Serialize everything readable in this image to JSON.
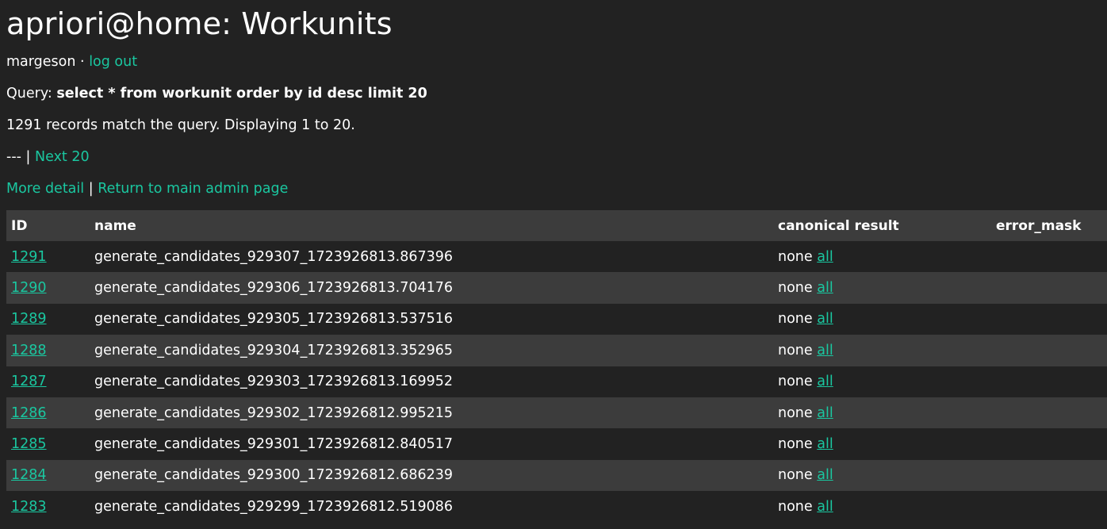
{
  "header": {
    "title": "apriori@home: Workunits"
  },
  "user": {
    "name": "margeson",
    "separator": "·",
    "logout_label": "log out"
  },
  "query": {
    "label": "Query:",
    "text": "select * from workunit order by id desc limit 20"
  },
  "records_info": "1291 records match the query. Displaying 1 to 20.",
  "pagination": {
    "prev": "---",
    "sep": "|",
    "next_label": "Next 20"
  },
  "links": {
    "more_detail": "More detail",
    "sep": "|",
    "return_admin": "Return to main admin page"
  },
  "table": {
    "headers": [
      "ID",
      "name",
      "canonical result",
      "error_mask"
    ],
    "rows": [
      {
        "id": "1291",
        "name": "generate_candidates_929307_1723926813.867396",
        "canonical": "none",
        "all": "all"
      },
      {
        "id": "1290",
        "name": "generate_candidates_929306_1723926813.704176",
        "canonical": "none",
        "all": "all"
      },
      {
        "id": "1289",
        "name": "generate_candidates_929305_1723926813.537516",
        "canonical": "none",
        "all": "all"
      },
      {
        "id": "1288",
        "name": "generate_candidates_929304_1723926813.352965",
        "canonical": "none",
        "all": "all"
      },
      {
        "id": "1287",
        "name": "generate_candidates_929303_1723926813.169952",
        "canonical": "none",
        "all": "all"
      },
      {
        "id": "1286",
        "name": "generate_candidates_929302_1723926812.995215",
        "canonical": "none",
        "all": "all"
      },
      {
        "id": "1285",
        "name": "generate_candidates_929301_1723926812.840517",
        "canonical": "none",
        "all": "all"
      },
      {
        "id": "1284",
        "name": "generate_candidates_929300_1723926812.686239",
        "canonical": "none",
        "all": "all"
      },
      {
        "id": "1283",
        "name": "generate_candidates_929299_1723926812.519086",
        "canonical": "none",
        "all": "all"
      }
    ]
  },
  "colors": {
    "background": "#222222",
    "row_alt": "#3c3c3c",
    "link": "#1ac7a0",
    "text": "#ffffff"
  }
}
